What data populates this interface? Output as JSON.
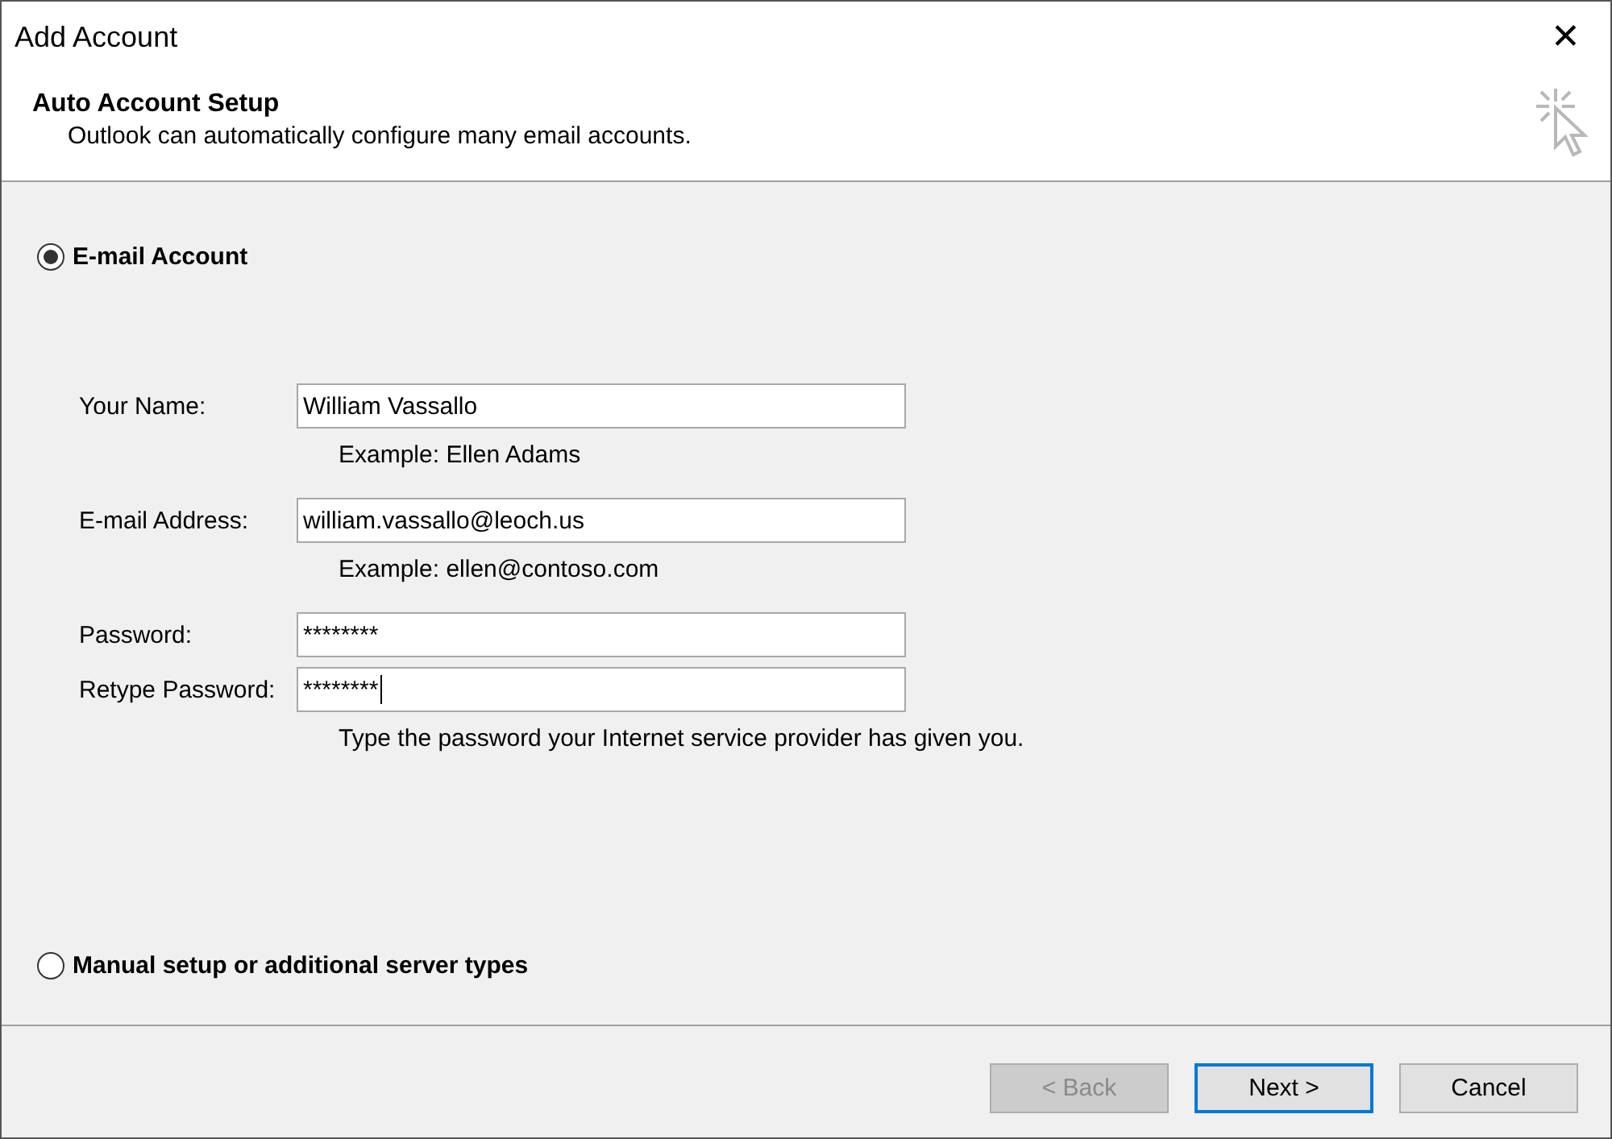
{
  "window": {
    "title": "Add Account",
    "close": "✕"
  },
  "header": {
    "title": "Auto Account Setup",
    "subtitle": "Outlook can automatically configure many email accounts."
  },
  "options": [
    {
      "label": "E-mail Account",
      "selected": true
    },
    {
      "label": "Manual setup or additional server types",
      "selected": false
    }
  ],
  "fields": [
    {
      "label": "Your Name:",
      "value": "William Vassallo",
      "hint": "Example: Ellen Adams",
      "focused": false
    },
    {
      "label": "E-mail Address:",
      "value": "william.vassallo@leoch.us",
      "hint": "Example: ellen@contoso.com",
      "focused": false
    },
    {
      "label": "Password:",
      "value": "********",
      "focused": false
    },
    {
      "label": "Retype Password:",
      "value": "********",
      "hint": "Type the password your Internet service provider has given you.",
      "focused": true
    }
  ],
  "buttons": [
    {
      "label": "< Back",
      "disabled": true,
      "default": false
    },
    {
      "label": "Next >",
      "disabled": false,
      "default": true
    },
    {
      "label": "Cancel",
      "disabled": false,
      "default": false
    }
  ]
}
